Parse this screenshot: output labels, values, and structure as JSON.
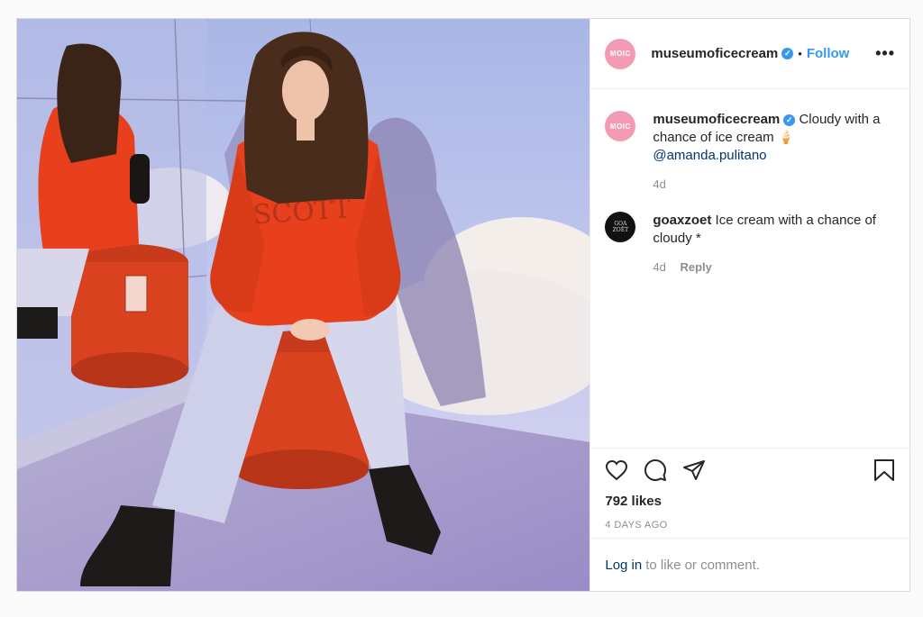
{
  "post": {
    "author": "museumoficecream",
    "author_avatar_text": "MOIC",
    "follow_label": "Follow",
    "separator": "•",
    "more_label": "•••",
    "caption": {
      "author": "museumoficecream",
      "text": "Cloudy with a chance of ice cream 🍦",
      "mention": "@amanda.pulitano",
      "age": "4d"
    },
    "comments": [
      {
        "author": "goaxzoet",
        "avatar_text_line1": "GOA",
        "avatar_text_line2": "ZOËT",
        "text": "Ice cream with a chance of cloudy *",
        "age": "4d",
        "reply_label": "Reply"
      }
    ],
    "likes": "792 likes",
    "posted": "4 DAYS AGO",
    "login_link": "Log in",
    "login_text": "to like or comment."
  },
  "icons": {
    "verified": "verified-badge-icon",
    "like": "heart-icon",
    "comment": "comment-bubble-icon",
    "share": "paper-plane-icon",
    "save": "bookmark-icon"
  },
  "colors": {
    "accent": "#3897f0",
    "link": "#00376b",
    "muted": "#8e8e8e",
    "avatar_pink": "#f49bb4",
    "hoodie": "#e8401c"
  }
}
